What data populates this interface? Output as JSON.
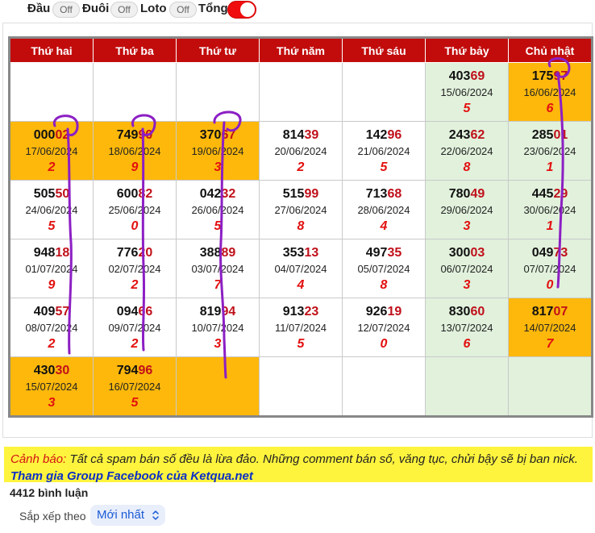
{
  "toggles": {
    "dau_label": "Đầu",
    "dau_state": "Off",
    "duoi_label": "Đuôi",
    "duoi_state": "Off",
    "loto_label": "Loto",
    "loto_state": "Off",
    "tong_label": "Tổng"
  },
  "calendar": {
    "headers": [
      "Thứ hai",
      "Thứ ba",
      "Thứ tư",
      "Thứ năm",
      "Thứ sáu",
      "Thứ bảy",
      "Chủ nhật"
    ],
    "weeks": [
      [
        null,
        null,
        null,
        null,
        null,
        {
          "head": "403",
          "tail": "69",
          "date": "15/06/2024",
          "sum": "5"
        },
        {
          "head": "175",
          "tail": "97",
          "date": "16/06/2024",
          "sum": "6",
          "hl": true
        }
      ],
      [
        {
          "head": "000",
          "tail": "02",
          "date": "17/06/2024",
          "sum": "2",
          "hl": true
        },
        {
          "head": "749",
          "tail": "90",
          "date": "18/06/2024",
          "sum": "9",
          "hl": true
        },
        {
          "head": "370",
          "tail": "67",
          "date": "19/06/2024",
          "sum": "3",
          "hl": true
        },
        {
          "head": "814",
          "tail": "39",
          "date": "20/06/2024",
          "sum": "2"
        },
        {
          "head": "142",
          "tail": "96",
          "date": "21/06/2024",
          "sum": "5"
        },
        {
          "head": "243",
          "tail": "62",
          "date": "22/06/2024",
          "sum": "8"
        },
        {
          "head": "285",
          "tail": "01",
          "date": "23/06/2024",
          "sum": "1"
        }
      ],
      [
        {
          "head": "505",
          "tail": "50",
          "date": "24/06/2024",
          "sum": "5"
        },
        {
          "head": "600",
          "tail": "82",
          "date": "25/06/2024",
          "sum": "0"
        },
        {
          "head": "042",
          "tail": "32",
          "date": "26/06/2024",
          "sum": "5"
        },
        {
          "head": "515",
          "tail": "99",
          "date": "27/06/2024",
          "sum": "8"
        },
        {
          "head": "713",
          "tail": "68",
          "date": "28/06/2024",
          "sum": "4"
        },
        {
          "head": "780",
          "tail": "49",
          "date": "29/06/2024",
          "sum": "3"
        },
        {
          "head": "445",
          "tail": "29",
          "date": "30/06/2024",
          "sum": "1"
        }
      ],
      [
        {
          "head": "948",
          "tail": "18",
          "date": "01/07/2024",
          "sum": "9"
        },
        {
          "head": "776",
          "tail": "20",
          "date": "02/07/2024",
          "sum": "2"
        },
        {
          "head": "388",
          "tail": "89",
          "date": "03/07/2024",
          "sum": "7"
        },
        {
          "head": "353",
          "tail": "13",
          "date": "04/07/2024",
          "sum": "4"
        },
        {
          "head": "497",
          "tail": "35",
          "date": "05/07/2024",
          "sum": "8"
        },
        {
          "head": "300",
          "tail": "03",
          "date": "06/07/2024",
          "sum": "3"
        },
        {
          "head": "049",
          "tail": "73",
          "date": "07/07/2024",
          "sum": "0"
        }
      ],
      [
        {
          "head": "409",
          "tail": "57",
          "date": "08/07/2024",
          "sum": "2"
        },
        {
          "head": "094",
          "tail": "66",
          "date": "09/07/2024",
          "sum": "2"
        },
        {
          "head": "819",
          "tail": "94",
          "date": "10/07/2024",
          "sum": "3"
        },
        {
          "head": "913",
          "tail": "23",
          "date": "11/07/2024",
          "sum": "5"
        },
        {
          "head": "926",
          "tail": "19",
          "date": "12/07/2024",
          "sum": "0"
        },
        {
          "head": "830",
          "tail": "60",
          "date": "13/07/2024",
          "sum": "6"
        },
        {
          "head": "817",
          "tail": "07",
          "date": "14/07/2024",
          "sum": "7",
          "hl": true
        }
      ],
      [
        {
          "head": "430",
          "tail": "30",
          "date": "15/07/2024",
          "sum": "3",
          "hl": true
        },
        {
          "head": "794",
          "tail": "96",
          "date": "16/07/2024",
          "sum": "5",
          "hl": true
        },
        {
          "empty": true,
          "hl": true
        },
        null,
        null,
        null,
        null
      ]
    ]
  },
  "notice": {
    "warning_label": "Cảnh báo:",
    "warning_text": " Tất cả spam bán số đều là lừa đảo. Những comment bán số, văng tục, chửi bậy sẽ bị ban nick.",
    "group_link": "Tham gia Group Facebook của Ketqua.net"
  },
  "comments": {
    "count_label": "4412 bình luận",
    "sort_label": "Sắp xếp theo",
    "sort_value": "Mới nhất",
    "sort_icon": "up-down-chevron-icon"
  },
  "colors": {
    "header_red": "#c20c0c",
    "highlight_orange": "#fdb80b",
    "weekend_green": "#e1f1dc",
    "tail_red": "#c0101a",
    "sum_red": "#e31010",
    "toggle_on": "#f00d0d",
    "warning_bg": "#fff43d",
    "pen_purple": "#8c1fc4"
  }
}
